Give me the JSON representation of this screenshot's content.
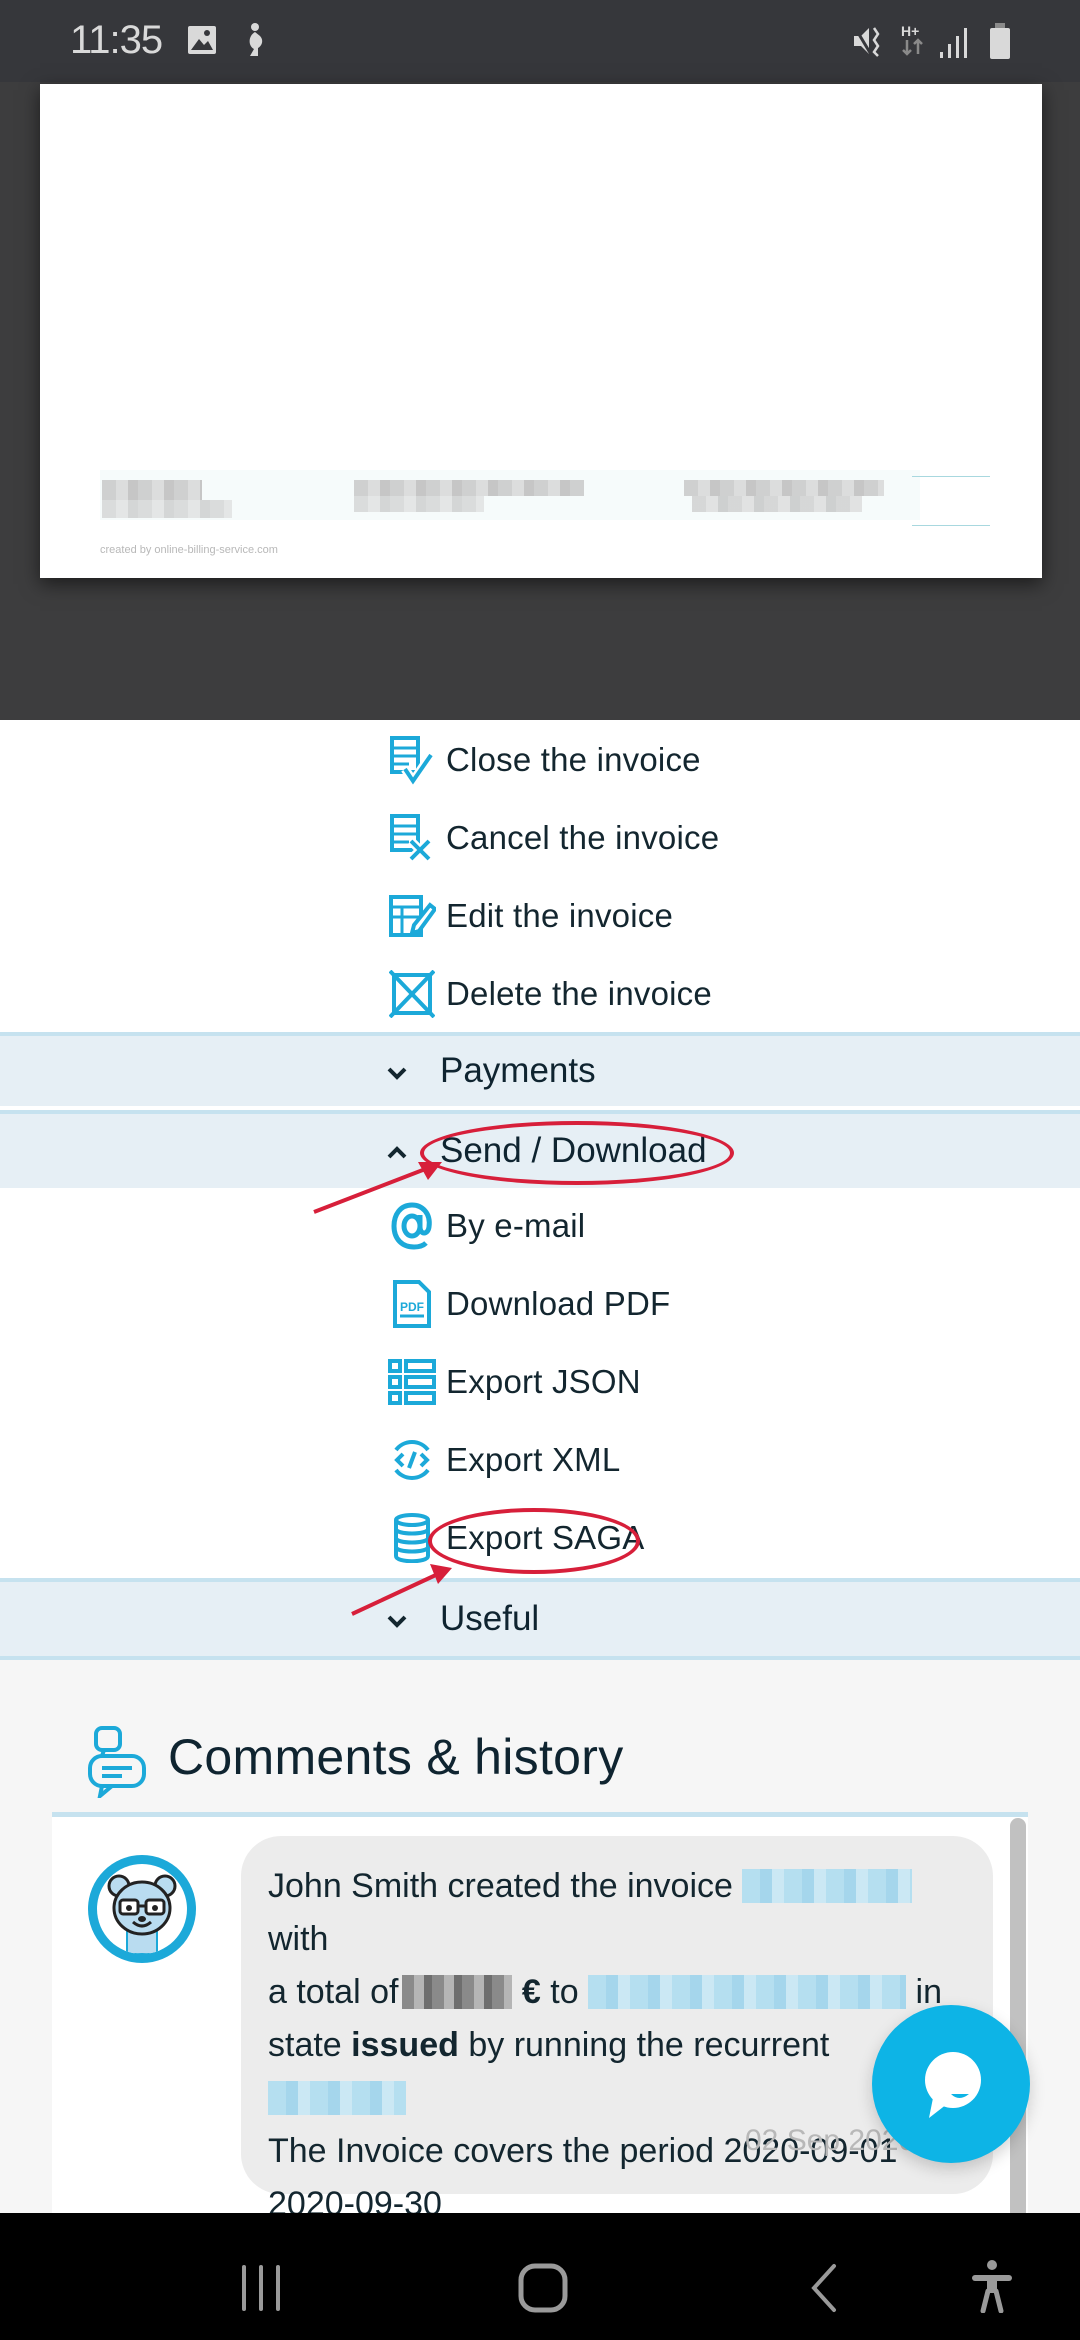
{
  "status_bar": {
    "time": "11:35",
    "left_icons": [
      "gallery-icon",
      "accessibility-service-icon"
    ],
    "right_icons": [
      "vibrate-mute-icon",
      "network-hplus-icon",
      "signal-icon",
      "battery-icon"
    ],
    "network_label": "H+"
  },
  "invoice_preview": {
    "credit": "created by online-billing-service.com",
    "redacted": true
  },
  "actions": {
    "items": [
      {
        "label": "Close the invoice",
        "icon": "invoice-check-icon"
      },
      {
        "label": "Cancel the invoice",
        "icon": "invoice-cancel-icon"
      },
      {
        "label": "Edit the invoice",
        "icon": "invoice-edit-icon"
      },
      {
        "label": "Delete the invoice",
        "icon": "delete-box-icon"
      }
    ]
  },
  "sections": {
    "payments": {
      "title": "Payments",
      "chevron": "⌄",
      "expanded": false
    },
    "send_download": {
      "title": "Send / Download",
      "chevron": "^",
      "expanded": true,
      "items": [
        {
          "label": "By e-mail",
          "icon": "at-sign-icon"
        },
        {
          "label": "Download PDF",
          "icon": "pdf-file-icon"
        },
        {
          "label": "Export JSON",
          "icon": "list-icon"
        },
        {
          "label": "Export XML",
          "icon": "code-icon"
        },
        {
          "label": "Export SAGA",
          "icon": "database-icon"
        }
      ]
    },
    "useful": {
      "title": "Useful",
      "chevron": "⌄",
      "expanded": false
    }
  },
  "annotations": {
    "highlighted": [
      "Send / Download",
      "Export SAGA"
    ],
    "color": "#d71f3a"
  },
  "comments": {
    "title": "Comments & history",
    "entries": [
      {
        "author": "John Smith",
        "text_1": "John Smith created the invoice",
        "text_2": "with",
        "text_3": "a total of",
        "currency": "€",
        "text_4": "to",
        "text_5": "in",
        "text_6": "state",
        "state": "issued",
        "text_7": "by running the recurrent",
        "text_8": "The Invoice covers the period 2020-09-01",
        "text_9": "2020-09-30",
        "timestamp": "02 Sep 2020 2"
      }
    ]
  },
  "chat_widget": {
    "icon": "chat-bubble-icon"
  },
  "nav_bar": {
    "buttons": [
      "recent-apps-icon",
      "home-icon",
      "back-icon",
      "accessibility-icon"
    ]
  },
  "colors": {
    "accent": "#1ca9d9",
    "section_bg": "#e6eff5",
    "section_border": "#c6e2ef",
    "fab": "#0db4e6",
    "text": "#13262f"
  }
}
